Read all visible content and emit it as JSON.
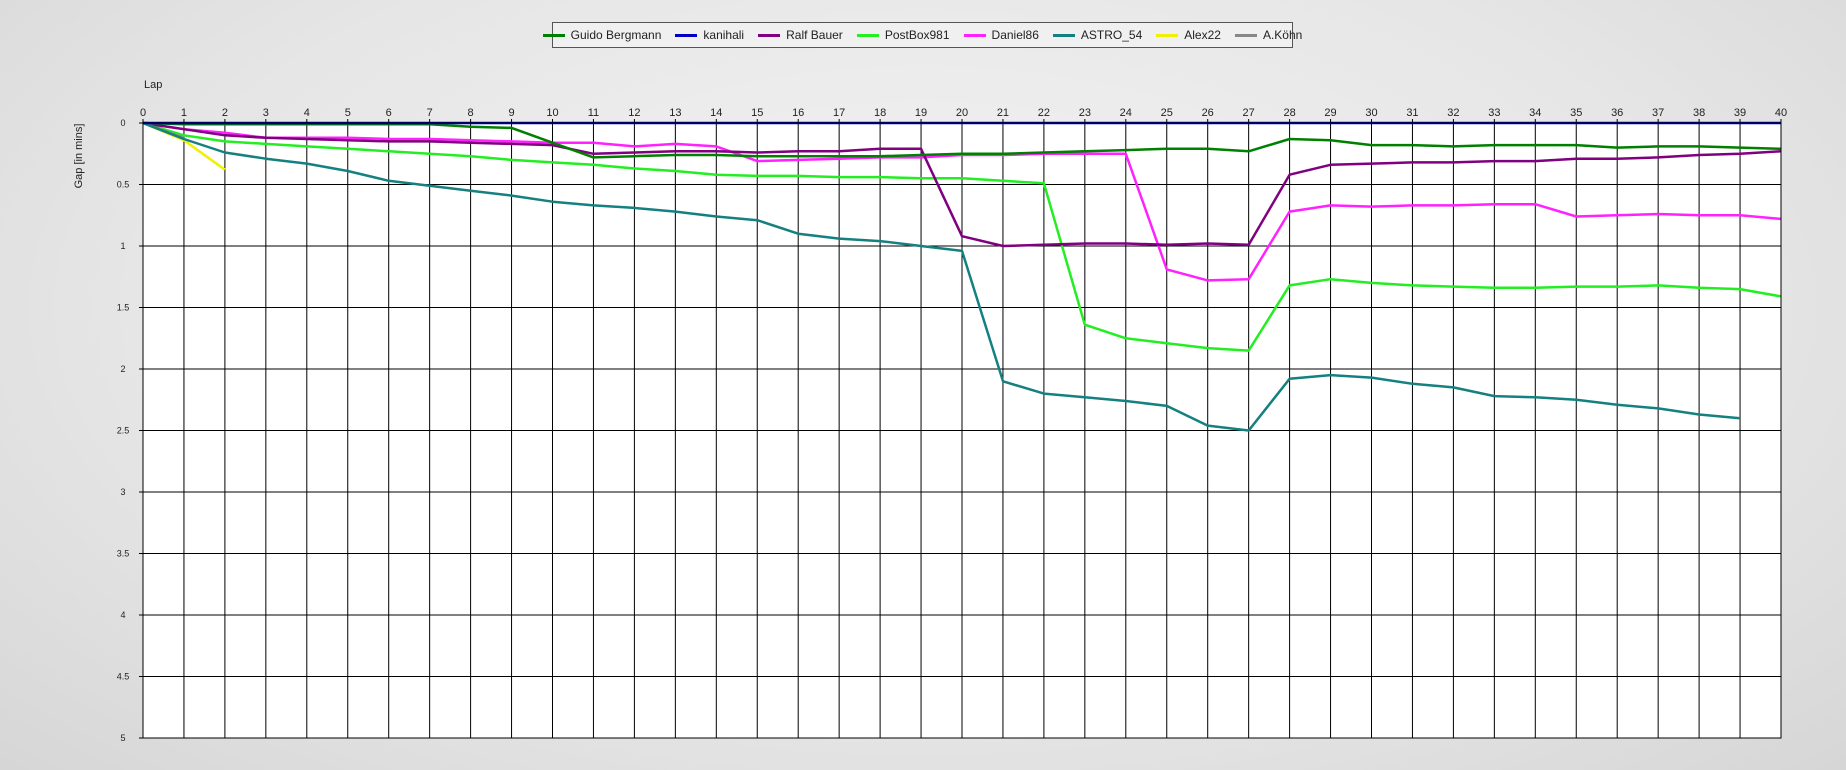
{
  "chart_data": {
    "type": "line",
    "xlabel": "Lap",
    "ylabel": "Gap [in mins]",
    "xlim": [
      0,
      40
    ],
    "ylim": [
      0,
      5
    ],
    "y_inverted": true,
    "grid": true,
    "legend_position": "top-center",
    "x": [
      0,
      1,
      2,
      3,
      4,
      5,
      6,
      7,
      8,
      9,
      10,
      11,
      12,
      13,
      14,
      15,
      16,
      17,
      18,
      19,
      20,
      21,
      22,
      23,
      24,
      25,
      26,
      27,
      28,
      29,
      30,
      31,
      32,
      33,
      34,
      35,
      36,
      37,
      38,
      39,
      40
    ],
    "x_ticks": [
      "0",
      "1",
      "2",
      "3",
      "4",
      "5",
      "6",
      "7",
      "8",
      "9",
      "10",
      "11",
      "12",
      "13",
      "14",
      "15",
      "16",
      "17",
      "18",
      "19",
      "20",
      "21",
      "22",
      "23",
      "24",
      "25",
      "26",
      "27",
      "28",
      "29",
      "30",
      "31",
      "32",
      "33",
      "34",
      "35",
      "36",
      "37",
      "38",
      "39",
      "40"
    ],
    "y_ticks": [
      "0",
      "0.5",
      "1",
      "1.5",
      "2",
      "2.5",
      "3",
      "3.5",
      "4",
      "4.5",
      "5"
    ],
    "y_tick_values": [
      0,
      0.5,
      1,
      1.5,
      2,
      2.5,
      3,
      3.5,
      4,
      4.5,
      5
    ],
    "series": [
      {
        "name": "Guido Bergmann",
        "color": "#008000",
        "values": [
          0,
          0.01,
          0.01,
          0.01,
          0.01,
          0.01,
          0.01,
          0.01,
          0.03,
          0.04,
          0.16,
          0.28,
          0.27,
          0.26,
          0.26,
          0.27,
          0.27,
          0.27,
          0.27,
          0.26,
          0.25,
          0.25,
          0.24,
          0.23,
          0.22,
          0.21,
          0.21,
          0.23,
          0.13,
          0.14,
          0.18,
          0.18,
          0.19,
          0.18,
          0.18,
          0.18,
          0.2,
          0.19,
          0.19,
          0.2,
          0.21
        ]
      },
      {
        "name": "kanihali",
        "color": "#0000c8",
        "values": [
          0,
          0,
          0,
          0,
          0,
          0,
          0,
          0,
          0,
          0,
          0,
          0,
          0,
          0,
          0,
          0,
          0,
          0,
          0,
          0,
          0,
          0,
          0,
          0,
          0,
          0,
          0,
          0,
          0,
          0,
          0,
          0,
          0,
          0,
          0,
          0,
          0,
          0,
          0,
          0,
          0
        ]
      },
      {
        "name": "Ralf Bauer",
        "color": "#800080",
        "values": [
          0,
          0.05,
          0.1,
          0.12,
          0.13,
          0.14,
          0.15,
          0.15,
          0.16,
          0.17,
          0.18,
          0.25,
          0.24,
          0.23,
          0.23,
          0.24,
          0.23,
          0.23,
          0.21,
          0.21,
          0.92,
          1.0,
          0.99,
          0.98,
          0.98,
          0.99,
          0.98,
          0.99,
          0.42,
          0.34,
          0.33,
          0.32,
          0.32,
          0.31,
          0.31,
          0.29,
          0.29,
          0.28,
          0.26,
          0.25,
          0.23
        ]
      },
      {
        "name": "PostBox981",
        "color": "#22ee22",
        "values": [
          0,
          0.1,
          0.15,
          0.17,
          0.19,
          0.21,
          0.23,
          0.25,
          0.27,
          0.3,
          0.32,
          0.34,
          0.37,
          0.39,
          0.42,
          0.43,
          0.43,
          0.44,
          0.44,
          0.45,
          0.45,
          0.47,
          0.49,
          1.64,
          1.75,
          1.79,
          1.83,
          1.85,
          1.32,
          1.27,
          1.3,
          1.32,
          1.33,
          1.34,
          1.34,
          1.33,
          1.33,
          1.32,
          1.34,
          1.35,
          1.41
        ]
      },
      {
        "name": "Daniel86",
        "color": "#ff22ff",
        "values": [
          0,
          0.05,
          0.08,
          0.12,
          0.12,
          0.12,
          0.13,
          0.13,
          0.14,
          0.15,
          0.16,
          0.16,
          0.19,
          0.17,
          0.19,
          0.31,
          0.3,
          0.29,
          0.28,
          0.28,
          0.26,
          0.26,
          0.25,
          0.25,
          0.25,
          1.19,
          1.28,
          1.27,
          0.72,
          0.67,
          0.68,
          0.67,
          0.67,
          0.66,
          0.66,
          0.76,
          0.75,
          0.74,
          0.75,
          0.75,
          0.78
        ]
      },
      {
        "name": "ASTRO_54",
        "color": "#158080",
        "values": [
          0,
          0.13,
          0.24,
          0.29,
          0.33,
          0.39,
          0.47,
          0.51,
          0.55,
          0.59,
          0.64,
          0.67,
          0.69,
          0.72,
          0.76,
          0.79,
          0.9,
          0.94,
          0.96,
          1.0,
          1.04,
          2.1,
          2.2,
          2.23,
          2.26,
          2.3,
          2.46,
          2.5,
          2.08,
          2.05,
          2.07,
          2.12,
          2.15,
          2.22,
          2.23,
          2.25,
          2.29,
          2.32,
          2.37,
          2.4,
          null
        ]
      },
      {
        "name": "Alex22",
        "color": "#f0f000",
        "values": [
          0,
          0.14,
          0.38,
          null,
          null,
          null,
          null,
          null,
          null,
          null,
          null,
          null,
          null,
          null,
          null,
          null,
          null,
          null,
          null,
          null,
          null,
          null,
          null,
          null,
          null,
          null,
          null,
          null,
          null,
          null,
          null,
          null,
          null,
          null,
          null,
          null,
          null,
          null,
          null,
          null,
          null
        ]
      },
      {
        "name": "A.Köhn",
        "color": "#888888",
        "values": [
          0,
          0.12,
          null,
          null,
          null,
          null,
          null,
          null,
          null,
          null,
          null,
          null,
          null,
          null,
          null,
          null,
          null,
          null,
          null,
          null,
          null,
          null,
          null,
          null,
          null,
          null,
          null,
          null,
          null,
          null,
          null,
          null,
          null,
          null,
          null,
          null,
          null,
          null,
          null,
          null,
          null
        ]
      }
    ]
  }
}
